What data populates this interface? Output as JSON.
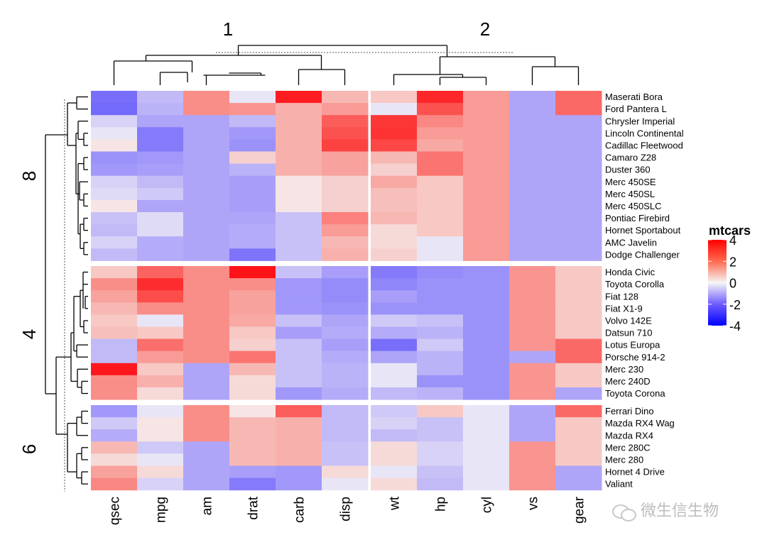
{
  "chart_data": {
    "type": "heatmap",
    "title": "",
    "legend": {
      "title": "mtcars",
      "ticks": [
        4,
        2,
        0,
        -2,
        -4
      ],
      "range": [
        -4,
        4
      ],
      "placement": "right",
      "colors": {
        "low": "#0000ff",
        "mid": "#ffffff",
        "high": "#ff0000"
      }
    },
    "column_splits": [
      {
        "label": "1",
        "columns": [
          "qsec",
          "mpg",
          "am",
          "drat",
          "carb",
          "disp"
        ]
      },
      {
        "label": "2",
        "columns": [
          "wt",
          "hp",
          "cyl",
          "vs",
          "gear"
        ]
      }
    ],
    "columns": [
      "qsec",
      "mpg",
      "am",
      "drat",
      "carb",
      "disp",
      "wt",
      "hp",
      "cyl",
      "vs",
      "gear"
    ],
    "row_splits": [
      {
        "label": "8",
        "rows": [
          "Maserati Bora",
          "Ford Pantera L",
          "Chrysler Imperial",
          "Lincoln Continental",
          "Cadillac Fleetwood",
          "Camaro Z28",
          "Duster 360",
          "Merc 450SE",
          "Merc 450SL",
          "Merc 450SLC",
          "Pontiac Firebird",
          "Hornet Sportabout",
          "AMC Javelin",
          "Dodge Challenger"
        ]
      },
      {
        "label": "4",
        "rows": [
          "Honda Civic",
          "Toyota Corolla",
          "Fiat 128",
          "Fiat X1-9",
          "Volvo 142E",
          "Datsun 710",
          "Lotus Europa",
          "Porsche 914-2",
          "Merc 230",
          "Merc 240D",
          "Toyota Corona"
        ]
      },
      {
        "label": "6",
        "rows": [
          "Ferrari Dino",
          "Mazda RX4 Wag",
          "Mazda RX4",
          "Merc 280C",
          "Merc 280",
          "Hornet 4 Drive",
          "Valiant"
        ]
      }
    ],
    "values": [
      [
        -1.8,
        -0.6,
        1.2,
        -0.1,
        3.2,
        0.6,
        0.4,
        3.0,
        1.0,
        -0.9,
        1.8
      ],
      [
        -1.9,
        -0.7,
        1.2,
        1.1,
        0.7,
        1.0,
        -0.1,
        2.2,
        1.0,
        -0.9,
        1.8
      ],
      [
        -0.3,
        -0.9,
        -0.9,
        -0.6,
        0.7,
        2.0,
        2.7,
        1.3,
        1.0,
        -0.9,
        -0.9
      ],
      [
        -0.1,
        -1.6,
        -0.9,
        -1.1,
        0.7,
        2.2,
        2.8,
        1.0,
        1.0,
        -0.9,
        -0.9
      ],
      [
        0.1,
        -1.6,
        -0.9,
        -1.2,
        0.7,
        2.5,
        2.4,
        0.8,
        1.0,
        -0.9,
        -0.9
      ],
      [
        -1.2,
        -1.1,
        -0.9,
        0.3,
        0.7,
        0.9,
        0.6,
        1.6,
        1.0,
        -0.9,
        -0.9
      ],
      [
        -1.1,
        -1.0,
        -0.9,
        -0.7,
        0.7,
        0.9,
        0.3,
        1.6,
        1.0,
        -0.9,
        -0.9
      ],
      [
        -0.3,
        -0.6,
        -0.9,
        -1.0,
        0.1,
        0.3,
        0.8,
        0.4,
        1.0,
        -0.9,
        -0.9
      ],
      [
        -0.2,
        -0.4,
        -0.9,
        -1.0,
        0.1,
        0.3,
        0.5,
        0.4,
        1.0,
        -0.9,
        -0.9
      ],
      [
        0.1,
        -0.9,
        -0.9,
        -1.0,
        0.1,
        0.3,
        0.5,
        0.4,
        1.0,
        -0.9,
        -0.9
      ],
      [
        -0.5,
        -0.2,
        -0.9,
        -0.9,
        -0.5,
        1.4,
        0.6,
        0.4,
        1.0,
        -0.9,
        -0.9
      ],
      [
        -0.6,
        -0.2,
        -0.9,
        -0.8,
        -0.5,
        1.0,
        0.2,
        0.4,
        1.0,
        -0.9,
        -0.9
      ],
      [
        -0.3,
        -0.8,
        -0.9,
        -0.8,
        -0.5,
        0.6,
        0.2,
        -0.1,
        1.0,
        -0.9,
        -0.9
      ],
      [
        -0.6,
        -0.8,
        -0.9,
        -1.7,
        -0.5,
        0.7,
        0.3,
        -0.1,
        1.0,
        -0.9,
        -0.9
      ],
      [
        0.4,
        1.9,
        1.2,
        3.4,
        -0.5,
        -1.0,
        -1.6,
        -1.3,
        -1.2,
        1.1,
        0.4
      ],
      [
        1.2,
        2.9,
        1.2,
        1.2,
        -1.1,
        -1.3,
        -1.4,
        -1.2,
        -1.2,
        1.1,
        0.4
      ],
      [
        0.9,
        2.3,
        1.2,
        0.9,
        -1.1,
        -1.3,
        -1.0,
        -1.2,
        -1.2,
        1.1,
        0.4
      ],
      [
        0.6,
        1.2,
        1.2,
        0.9,
        -1.1,
        -1.2,
        -1.2,
        -1.2,
        -1.2,
        1.1,
        0.4
      ],
      [
        0.4,
        -0.1,
        1.2,
        0.8,
        -0.5,
        -0.9,
        -0.4,
        -0.5,
        -1.2,
        1.1,
        0.4
      ],
      [
        0.5,
        0.4,
        1.2,
        0.4,
        -1.0,
        -0.8,
        -0.8,
        -0.7,
        -1.2,
        1.1,
        0.4
      ],
      [
        -0.6,
        1.7,
        1.2,
        0.3,
        -0.5,
        -1.0,
        -1.8,
        -0.4,
        -1.2,
        1.1,
        1.8
      ],
      [
        -0.6,
        1.0,
        1.2,
        1.6,
        -0.5,
        -0.8,
        -0.9,
        -0.7,
        -1.2,
        -0.9,
        1.8
      ],
      [
        3.3,
        0.4,
        -0.9,
        0.6,
        -0.5,
        -0.7,
        -0.1,
        -0.7,
        -1.2,
        1.1,
        0.4
      ],
      [
        1.2,
        0.7,
        -0.9,
        0.2,
        -0.5,
        -0.7,
        -0.1,
        -1.2,
        -1.2,
        1.1,
        0.4
      ],
      [
        1.2,
        0.2,
        -0.9,
        0.2,
        -1.1,
        -0.8,
        -0.6,
        -0.7,
        -1.2,
        1.1,
        -0.9
      ],
      [
        -1.1,
        -0.1,
        1.2,
        0.1,
        2.0,
        -0.6,
        -0.4,
        0.4,
        -0.1,
        -0.9,
        1.8
      ],
      [
        -0.4,
        0.1,
        1.2,
        0.6,
        0.7,
        -0.6,
        -0.3,
        -0.5,
        -0.1,
        -0.9,
        0.4
      ],
      [
        -0.8,
        0.1,
        1.2,
        0.6,
        0.7,
        -0.6,
        -0.6,
        -0.5,
        -0.1,
        -0.9,
        0.4
      ],
      [
        0.6,
        -0.4,
        -0.9,
        0.6,
        0.7,
        -0.5,
        0.2,
        -0.3,
        -0.1,
        1.1,
        0.4
      ],
      [
        0.2,
        -0.1,
        -0.9,
        0.6,
        0.7,
        -0.5,
        0.2,
        -0.3,
        -0.1,
        1.1,
        0.4
      ],
      [
        0.9,
        0.2,
        -0.9,
        -1.0,
        -1.1,
        0.2,
        -0.1,
        -0.5,
        -0.1,
        1.1,
        -0.9
      ],
      [
        1.3,
        -0.3,
        -0.9,
        -1.6,
        -1.1,
        -0.1,
        0.2,
        -0.6,
        -0.1,
        1.1,
        -0.9
      ]
    ]
  },
  "watermark": {
    "text": "微生信生物"
  }
}
